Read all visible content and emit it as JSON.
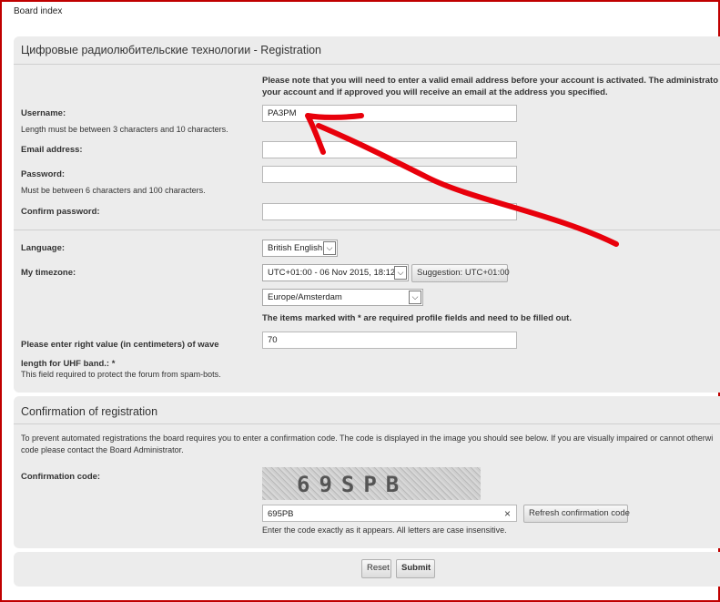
{
  "breadcrumb": "Board index",
  "registration": {
    "title": "Цифровые радиолюбительские технологии - Registration",
    "notice_line1": "Please note that you will need to enter a valid email address before your account is activated. The administrato",
    "notice_line2": "your account and if approved you will receive an email at the address you specified.",
    "username_label": "Username:",
    "username_hint": "Length must be between 3 characters and 10 characters.",
    "username_value": "PA3PM",
    "email_label": "Email address:",
    "email_value": "",
    "password_label": "Password:",
    "password_hint": "Must be between 6 characters and 100 characters.",
    "confirm_password_label": "Confirm password:",
    "language_label": "Language:",
    "language_value": "British English",
    "timezone_label": "My timezone:",
    "timezone_value": "UTC+01:00 - 06 Nov 2015, 18:12",
    "timezone_suggestion": "Suggestion: UTC+01:00",
    "timezone_region": "Europe/Amsterdam",
    "required_note": "The items marked with * are required profile fields and need to be filled out.",
    "wave_label_line1": "Please enter right value (in centimeters) of wave",
    "wave_label_line2": "length for UHF band.: *",
    "wave_value": "70",
    "wave_hint": "This field required to protect the forum from spam-bots."
  },
  "confirmation": {
    "title": "Confirmation of registration",
    "explain_line1": "To prevent automated registrations the board requires you to enter a confirmation code. The code is displayed in the image you should see below. If you are visually impaired or cannot otherwi",
    "explain_line2": "code please contact the Board Administrator.",
    "code_label": "Confirmation code:",
    "captcha_text": "69SPB",
    "code_value": "695PB",
    "refresh_label": "Refresh confirmation code",
    "code_hint": "Enter the code exactly as it appears. All letters are case insensitive.",
    "clear_glyph": "×"
  },
  "actions": {
    "reset_label": "Reset",
    "submit_label": "Submit"
  },
  "icons": {
    "dropdown": "chevron-down-icon",
    "arrow_annotation": "red-hand-drawn-arrow",
    "annotation_color": "#e8000b"
  }
}
